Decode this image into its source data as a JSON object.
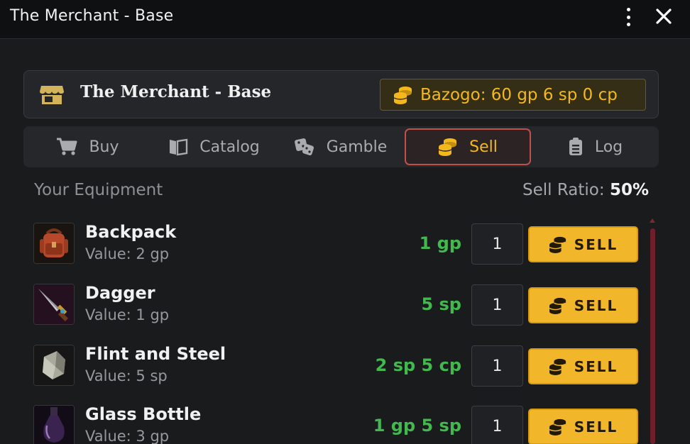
{
  "window": {
    "title": "The Merchant - Base"
  },
  "header": {
    "shop_name": "The Merchant - Base",
    "wallet": "Bazogo: 60 gp 6 sp 0 cp"
  },
  "tabs": [
    {
      "label": "Buy",
      "icon": "cart-icon",
      "active": false
    },
    {
      "label": "Catalog",
      "icon": "book-icon",
      "active": false
    },
    {
      "label": "Gamble",
      "icon": "dice-icon",
      "active": false
    },
    {
      "label": "Sell",
      "icon": "coins-icon",
      "active": true
    },
    {
      "label": "Log",
      "icon": "clipboard-icon",
      "active": false
    }
  ],
  "section": {
    "title": "Your Equipment",
    "ratio_label": "Sell Ratio:",
    "ratio_value": "50%"
  },
  "sell_label": "SELL",
  "items": [
    {
      "name": "Backpack",
      "value": "Value: 2 gp",
      "price": "1 gp",
      "qty": "1",
      "icon": "backpack-icon"
    },
    {
      "name": "Dagger",
      "value": "Value: 1 gp",
      "price": "5 sp",
      "qty": "1",
      "icon": "dagger-icon"
    },
    {
      "name": "Flint and Steel",
      "value": "Value: 5 sp",
      "price": "2 sp 5 cp",
      "qty": "1",
      "icon": "flint-icon"
    },
    {
      "name": "Glass Bottle",
      "value": "Value: 3 gp",
      "price": "1 gp 5 sp",
      "qty": "1",
      "icon": "bottle-icon"
    }
  ],
  "colors": {
    "accent_gold": "#f4b81c",
    "price_green": "#42b84f",
    "active_tab_border": "#c1504a",
    "scrollbar": "#6e1f2a"
  }
}
